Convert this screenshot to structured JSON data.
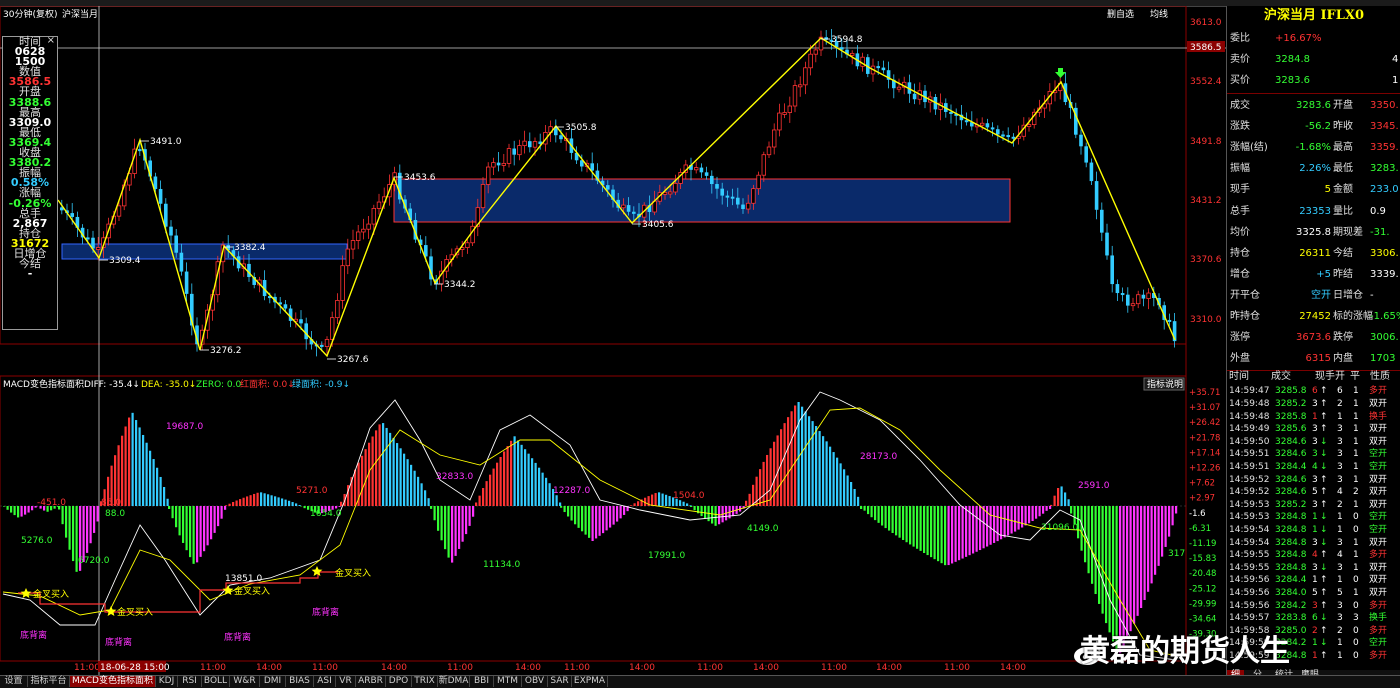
{
  "chart_header": {
    "period_label": "30分钟(复权)",
    "symbol_label": "沪深当月",
    "right_buttons": [
      "删自选",
      "均线"
    ]
  },
  "price_axis": {
    "ticks": [
      "3613.0",
      "3586.5",
      "3552.4",
      "3491.8",
      "3431.2",
      "3370.6",
      "3310.0"
    ],
    "current_price_badge": "3586.5"
  },
  "info_box": {
    "close_glyph": "×",
    "rows": [
      {
        "label": "时间",
        "value": "0628",
        "color": "#ffffff"
      },
      {
        "label": "",
        "value": "1500",
        "color": "#ffffff"
      },
      {
        "label": "数值",
        "value": "3586.5",
        "color": "#ff3333"
      },
      {
        "label": "开盘",
        "value": "3388.6",
        "color": "#33ff33"
      },
      {
        "label": "最高",
        "value": "3309.0",
        "color": "#ffffff"
      },
      {
        "label": "最低",
        "value": "3369.4",
        "color": "#33ff33"
      },
      {
        "label": "收盘",
        "value": "3380.2",
        "color": "#33ff33"
      },
      {
        "label": "振幅",
        "value": "0.58%",
        "color": "#33ccff"
      },
      {
        "label": "涨幅",
        "value": "-0.26%",
        "color": "#33ff33"
      },
      {
        "label": "总手",
        "value": "2,867",
        "color": "#ffffff"
      },
      {
        "label": "持仓",
        "value": "31672",
        "color": "#ffff00"
      },
      {
        "label": "日增仓",
        "value": "",
        "color": "#ffffff"
      },
      {
        "label": "今结",
        "value": "-",
        "color": "#ffffff"
      }
    ]
  },
  "kline": {
    "zigzag_labels": [
      {
        "text": "3491.0",
        "dir": "up"
      },
      {
        "text": "3309.4",
        "dir": "down"
      },
      {
        "text": "3276.2",
        "dir": "down"
      },
      {
        "text": "3382.4",
        "dir": "up"
      },
      {
        "text": "3267.6",
        "dir": "down"
      },
      {
        "text": "3453.6",
        "dir": "up"
      },
      {
        "text": "3344.2",
        "dir": "down"
      },
      {
        "text": "3505.8",
        "dir": "up"
      },
      {
        "text": "3405.6",
        "dir": "down"
      },
      {
        "text": "3594.8",
        "dir": "up"
      }
    ]
  },
  "macd": {
    "header": {
      "name": "MACD变色指标面积",
      "diff": "DIFF: -35.4↓",
      "dea": "DEA: -35.0↓",
      "zero": "ZERO: 0.0",
      "red_area": "红面积: 0.0↓",
      "green_area": "绿面积: -0.9↓"
    },
    "help_button": "指标说明",
    "axis_ticks": [
      "+35.71",
      "+31.07",
      "+26.42",
      "+21.78",
      "+17.14",
      "+12.26",
      "+7.62",
      "+2.97",
      "-1.6",
      "-6.31",
      "-11.19",
      "-15.83",
      "-20.48",
      "-25.12",
      "-29.99",
      "-34.64",
      "-39.30"
    ],
    "area_labels": [
      "-451.0",
      "19687.0",
      "85.0",
      "88.0",
      "5276.0",
      "6720.0",
      "5271.0",
      "1654.0",
      "32833.0",
      "12287.0",
      "11134.0",
      "1504.0",
      "17991.0",
      "4149.0",
      "28173.0",
      "2591.0",
      "31096.0",
      "317",
      "13851.0"
    ],
    "signal_labels": [
      "金叉买入",
      "金叉买入",
      "金叉买入",
      "金叉买入"
    ],
    "divergence_labels": [
      "底背离",
      "底背离",
      "底背离",
      "底背离"
    ]
  },
  "time_axis": {
    "ticks": [
      "11:00",
      "18-06-28 15:00",
      "11:00",
      "14:00",
      "11:00",
      "14:00",
      "11:00",
      "14:00",
      "11:00",
      "14:00",
      "11:00",
      "14:00",
      "11:00",
      "14:00",
      "11:00",
      "14:00"
    ]
  },
  "right_panel": {
    "title": "沪深当月 IFLX0",
    "rows": [
      {
        "label": "委比",
        "value": "+16.67%",
        "value_color": "#ff3333"
      },
      {
        "label": "卖价",
        "value": "3284.8",
        "value_color": "#33ff33",
        "extra": "4"
      },
      {
        "label": "买价",
        "value": "3283.6",
        "value_color": "#33ff33",
        "extra": "1"
      }
    ],
    "grid": [
      {
        "l1": "成交",
        "v1": "3283.6",
        "c1": "#33ff33",
        "l2": "开盘",
        "v2": "3350.",
        "c2": "#ff3333"
      },
      {
        "l1": "涨跌",
        "v1": "-56.2",
        "c1": "#33ff33",
        "l2": "昨收",
        "v2": "3345.",
        "c2": "#ff3333"
      },
      {
        "l1": "涨幅(结)",
        "v1": "-1.68%",
        "c1": "#33ff33",
        "l2": "最高",
        "v2": "3359.",
        "c2": "#ff3333"
      },
      {
        "l1": "振幅",
        "v1": "2.26%",
        "c1": "#33ccff",
        "l2": "最低",
        "v2": "3283.",
        "c2": "#33ff33"
      },
      {
        "l1": "现手",
        "v1": "5",
        "c1": "#ffff00",
        "l2": "金额",
        "v2": "233.0",
        "c2": "#33ccff"
      },
      {
        "l1": "总手",
        "v1": "23353",
        "c1": "#33ccff",
        "l2": "量比",
        "v2": "0.9",
        "c2": "#ffffff"
      },
      {
        "l1": "均价",
        "v1": "3325.8",
        "c1": "#ffffff",
        "l2": "期现差",
        "v2": "-31.",
        "c2": "#33ff33"
      },
      {
        "l1": "持仓",
        "v1": "26311",
        "c1": "#ffff00",
        "l2": "今结",
        "v2": "3306.",
        "c2": "#ffff00"
      },
      {
        "l1": "增仓",
        "v1": "+5",
        "c1": "#33ccff",
        "l2": "昨结",
        "v2": "3339.",
        "c2": "#ffffff"
      },
      {
        "l1": "开平仓",
        "v1": "空开",
        "c1": "#33ccff",
        "l2": "日增仓",
        "v2": "-",
        "c2": "#ffffff"
      },
      {
        "l1": "昨持仓",
        "v1": "27452",
        "c1": "#ffff00",
        "l2": "标的涨幅",
        "v2": "-1.65%",
        "c2": "#33ff33"
      },
      {
        "l1": "涨停",
        "v1": "3673.6",
        "c1": "#ff3333",
        "l2": "跌停",
        "v2": "3006.",
        "c2": "#33ff33"
      },
      {
        "l1": "外盘",
        "v1": "6315",
        "c1": "#ff3333",
        "l2": "内盘",
        "v2": "1703",
        "c2": "#33ff33"
      }
    ],
    "ticks_header": [
      "时间",
      "成交",
      "现手",
      "开",
      "平",
      "性质"
    ],
    "ticks": [
      {
        "t": "14:59:47",
        "p": "3285.8",
        "v": "6",
        "a": "↑",
        "o": "6",
        "c": "1",
        "n": "多开",
        "col": "#ff3333"
      },
      {
        "t": "14:59:48",
        "p": "3285.2",
        "v": "3",
        "a": "↑",
        "o": "2",
        "c": "1",
        "n": "双开",
        "col": "#ffffff"
      },
      {
        "t": "14:59:48",
        "p": "3285.8",
        "v": "1",
        "a": "↑",
        "o": "1",
        "c": "1",
        "n": "换手",
        "col": "#ff3333"
      },
      {
        "t": "14:59:49",
        "p": "3285.6",
        "v": "3",
        "a": "↑",
        "o": "3",
        "c": "1",
        "n": "双开",
        "col": "#ffffff"
      },
      {
        "t": "14:59:50",
        "p": "3284.6",
        "v": "3",
        "a": "↓",
        "o": "3",
        "c": "1",
        "n": "双开",
        "col": "#ffffff"
      },
      {
        "t": "14:59:51",
        "p": "3284.6",
        "v": "3",
        "a": "↓",
        "o": "3",
        "c": "1",
        "n": "空开",
        "col": "#33ff33"
      },
      {
        "t": "14:59:51",
        "p": "3284.4",
        "v": "4",
        "a": "↓",
        "o": "3",
        "c": "1",
        "n": "空开",
        "col": "#33ff33"
      },
      {
        "t": "14:59:52",
        "p": "3284.6",
        "v": "3",
        "a": "↑",
        "o": "3",
        "c": "1",
        "n": "双开",
        "col": "#ffffff"
      },
      {
        "t": "14:59:52",
        "p": "3284.6",
        "v": "5",
        "a": "↑",
        "o": "4",
        "c": "2",
        "n": "双开",
        "col": "#ffffff"
      },
      {
        "t": "14:59:53",
        "p": "3285.2",
        "v": "3",
        "a": "↑",
        "o": "2",
        "c": "1",
        "n": "双开",
        "col": "#ffffff"
      },
      {
        "t": "14:59:53",
        "p": "3284.8",
        "v": "1",
        "a": "↓",
        "o": "1",
        "c": "0",
        "n": "空开",
        "col": "#33ff33"
      },
      {
        "t": "14:59:54",
        "p": "3284.8",
        "v": "1",
        "a": "↓",
        "o": "1",
        "c": "0",
        "n": "空开",
        "col": "#33ff33"
      },
      {
        "t": "14:59:54",
        "p": "3284.8",
        "v": "3",
        "a": "↓",
        "o": "3",
        "c": "1",
        "n": "双开",
        "col": "#ffffff"
      },
      {
        "t": "14:59:55",
        "p": "3284.8",
        "v": "4",
        "a": "↑",
        "o": "4",
        "c": "1",
        "n": "多开",
        "col": "#ff3333"
      },
      {
        "t": "14:59:55",
        "p": "3284.8",
        "v": "3",
        "a": "↓",
        "o": "3",
        "c": "1",
        "n": "双开",
        "col": "#ffffff"
      },
      {
        "t": "14:59:56",
        "p": "3284.4",
        "v": "1",
        "a": "↑",
        "o": "1",
        "c": "0",
        "n": "双开",
        "col": "#ffffff"
      },
      {
        "t": "14:59:56",
        "p": "3284.0",
        "v": "5",
        "a": "↑",
        "o": "5",
        "c": "1",
        "n": "双开",
        "col": "#ffffff"
      },
      {
        "t": "14:59:56",
        "p": "3284.2",
        "v": "3",
        "a": "↑",
        "o": "3",
        "c": "0",
        "n": "多开",
        "col": "#ff3333"
      },
      {
        "t": "14:59:57",
        "p": "3283.8",
        "v": "6",
        "a": "↓",
        "o": "3",
        "c": "3",
        "n": "换手",
        "col": "#33ff33"
      },
      {
        "t": "14:59:58",
        "p": "3285.0",
        "v": "2",
        "a": "↑",
        "o": "2",
        "c": "0",
        "n": "多开",
        "col": "#ff3333"
      },
      {
        "t": "14:59:59",
        "p": "3284.2",
        "v": "1",
        "a": "↓",
        "o": "1",
        "c": "0",
        "n": "空开",
        "col": "#33ff33"
      },
      {
        "t": "14:59:59",
        "p": "3284.8",
        "v": "1",
        "a": "↑",
        "o": "1",
        "c": "0",
        "n": "多开",
        "col": "#ff3333"
      }
    ],
    "bottom_tabs": [
      "细",
      "分",
      "统计",
      "鹰眼"
    ]
  },
  "bottom_tabs": [
    "设置",
    "指标平台",
    "MACD变色指标面积",
    "KDJ",
    "RSI",
    "BOLL",
    "W&R",
    "DMI",
    "BIAS",
    "ASI",
    "VR",
    "ARBR",
    "DPO",
    "TRIX",
    "新DMA",
    "BBI",
    "MTM",
    "OBV",
    "SAR",
    "EXPMA"
  ],
  "watermark": "黄磊的期货人生",
  "colors": {
    "up": "#ff3333",
    "down": "#33ccff",
    "zigzag": "#ffff00",
    "box": "#0a2a6a"
  }
}
